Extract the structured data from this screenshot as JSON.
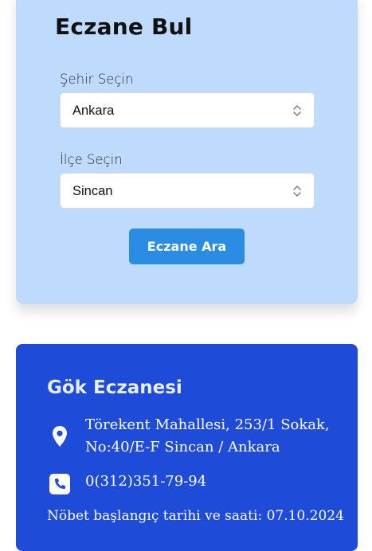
{
  "search": {
    "title": "Eczane Bul",
    "city_label": "Şehir Seçin",
    "city_value": "Ankara",
    "district_label": "İlçe Seçin",
    "district_value": "Sincan",
    "button_label": "Eczane Ara"
  },
  "pharmacy": {
    "name": "Gök Eczanesi",
    "address": "Törekent Mahallesi, 253/1 Sokak, No:40/E-F Sincan / Ankara",
    "phone": "0(312)351-79-94",
    "duty_start": "Nöbet başlangıç tarihi ve saati: 07.10.2024"
  },
  "icons": {
    "location": "location-pin-icon",
    "phone": "phone-icon",
    "select": "chevron-up-down-icon"
  },
  "colors": {
    "search_card_bg": "#bedbfe",
    "button_bg": "#2a8de3",
    "result_card_bg": "#1e4bd8"
  }
}
